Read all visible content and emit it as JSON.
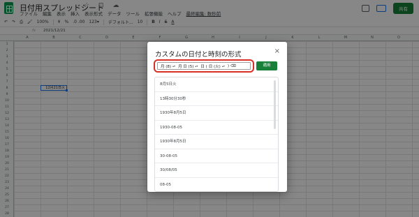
{
  "header": {
    "doc_title": "日付用スプレッドシート",
    "title_icons": "☆ ⊡ ☁",
    "menu": [
      "ファイル",
      "編集",
      "表示",
      "挿入",
      "表示形式",
      "データ",
      "ツール",
      "拡張機能",
      "ヘルプ"
    ],
    "last_edit": "最終編集: 数秒前",
    "share_label": "共有"
  },
  "toolbar": {
    "zoom": "100%",
    "currency": "¥",
    "percent": "%",
    "decimals": ".0  .00",
    "number_format": "123▾",
    "font": "デフォルト...",
    "font_size": "10",
    "bold": "B",
    "italic": "I",
    "strike": "S",
    "text_color": "A"
  },
  "formula_bar": {
    "fx": "fx",
    "value": "2021/12/21"
  },
  "grid": {
    "columns": [
      "A",
      "B",
      "C",
      "D",
      "E",
      "F",
      "G",
      "H",
      "I",
      "J",
      "K",
      "L",
      "M",
      "N",
      "O"
    ],
    "rows": [
      "1",
      "2",
      "3",
      "4",
      "5",
      "6",
      "7",
      "8",
      "9",
      "10",
      "11",
      "12",
      "13",
      "14",
      "15",
      "16",
      "17",
      "18",
      "19",
      "20",
      "21",
      "22",
      "23",
      "24",
      "25",
      "26",
      "27",
      "28"
    ],
    "selected_cell_value": "12月21日火"
  },
  "dialog": {
    "title": "カスタムの日付と時刻の形式",
    "close": "×",
    "format_chips": [
      "月 (8)",
      "月 日 (5)",
      "日 (",
      "日 (火)",
      ")"
    ],
    "format_trailing": "⌫",
    "apply_label": "適用",
    "options": [
      "8月5日火",
      "13時30分30秒",
      "1930年8月5日",
      "1930-08-05",
      "1930年8月5日",
      "30-08-05",
      "30/08/05",
      "08-05"
    ]
  }
}
